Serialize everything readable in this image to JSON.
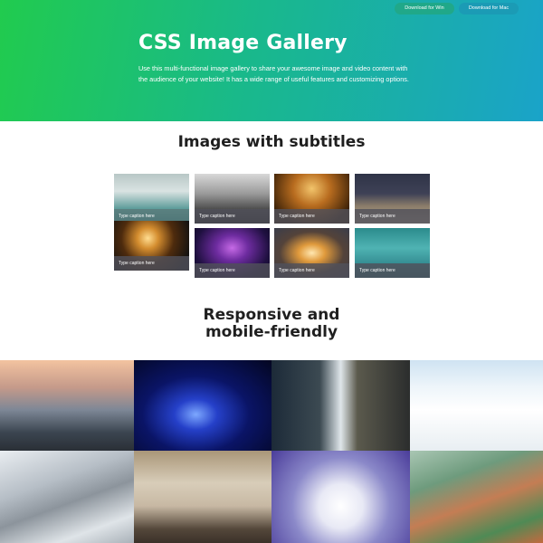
{
  "header": {
    "download_win": "Download for Win",
    "download_mac": "Download for Mac",
    "title": "CSS Image Gallery",
    "description": "Use this multi-functional image gallery to share your awesome image and video content with the audience of your website! It has a wide range of useful features and customizing options."
  },
  "section1": {
    "title": "Images with subtitles",
    "captions": [
      "Type caption here",
      "Type caption here",
      "Type caption here",
      "Type caption here",
      "Type caption here",
      "Type caption here",
      "Type caption here",
      "Type caption here"
    ]
  },
  "section2": {
    "title_line1": "Responsive and",
    "title_line2": "mobile-friendly"
  },
  "colors": {
    "hero_start": "#21cb4e",
    "hero_end": "#1aa3c9",
    "caption_bg": "#50505a"
  }
}
